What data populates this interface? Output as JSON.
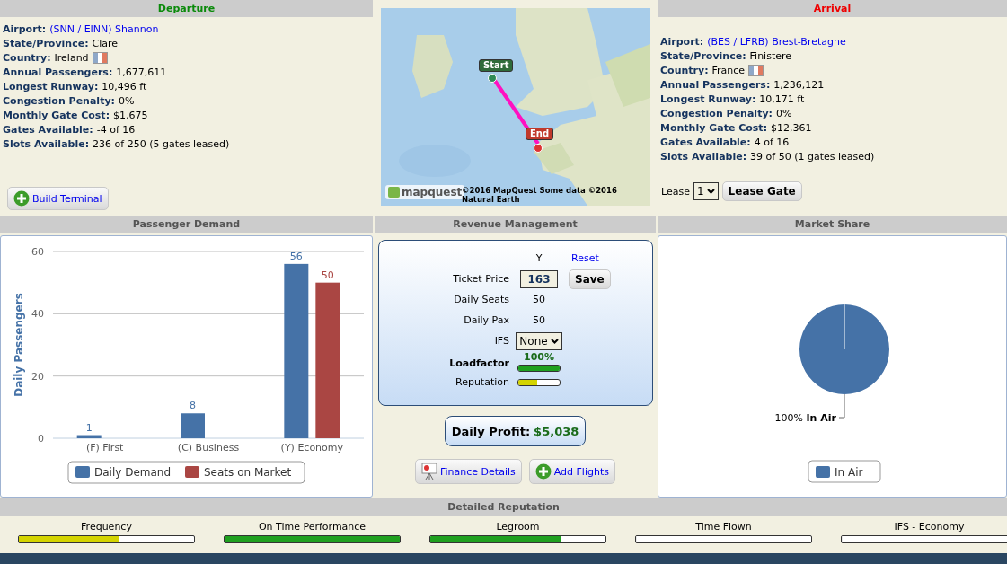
{
  "departure": {
    "title": "Departure",
    "fields": [
      {
        "label": "Airport:",
        "value": "(SNN / EINN) Shannon",
        "kind": "link"
      },
      {
        "label": "State/Province:",
        "value": "Clare",
        "kind": "text"
      },
      {
        "label": "Country:",
        "value": "Ireland",
        "kind": "flag"
      },
      {
        "label": "Annual Passengers:",
        "value": "1,677,611",
        "kind": "text"
      },
      {
        "label": "Longest Runway:",
        "value": "10,496 ft",
        "kind": "text"
      },
      {
        "label": "Congestion Penalty:",
        "value": "0%",
        "kind": "text"
      },
      {
        "label": "Monthly Gate Cost:",
        "value": "$1,675",
        "kind": "text"
      },
      {
        "label": "Gates Available:",
        "value": "-4 of 16",
        "kind": "text"
      },
      {
        "label": "Slots Available:",
        "value": "236 of 250 (5 gates leased)",
        "kind": "text"
      }
    ],
    "button": "Build Terminal"
  },
  "map": {
    "kind": "picture",
    "start_label": "Start",
    "end_label": "End",
    "logo": "mapquest",
    "attribution": "©2016 MapQuest Some data ©2016 Natural Earth"
  },
  "arrival": {
    "title": "Arrival",
    "fields": [
      {
        "label": "Airport:",
        "value": "(BES / LFRB) Brest-Bretagne",
        "kind": "link"
      },
      {
        "label": "State/Province:",
        "value": "Finistere",
        "kind": "text"
      },
      {
        "label": "Country:",
        "value": "France",
        "kind": "flag"
      },
      {
        "label": "Annual Passengers:",
        "value": "1,236,121",
        "kind": "text"
      },
      {
        "label": "Longest Runway:",
        "value": "10,171 ft",
        "kind": "text"
      },
      {
        "label": "Congestion Penalty:",
        "value": "0%",
        "kind": "text"
      },
      {
        "label": "Monthly Gate Cost:",
        "value": "$12,361",
        "kind": "text"
      },
      {
        "label": "Gates Available:",
        "value": "4 of 16",
        "kind": "text"
      },
      {
        "label": "Slots Available:",
        "value": "39 of 50 (1 gates leased)",
        "kind": "text"
      }
    ],
    "lease_label": "Lease",
    "lease_value": "1",
    "button": "Lease Gate"
  },
  "passenger_demand": {
    "title": "Passenger Demand",
    "chart_data": {
      "type": "bar",
      "ylabel": "Daily Passengers",
      "categories": [
        "(F) First",
        "(C) Business",
        "(Y) Economy"
      ],
      "series": [
        {
          "name": "Daily Demand",
          "color": "#4572a7",
          "values": [
            1,
            8,
            56
          ]
        },
        {
          "name": "Seats on Market",
          "color": "#aa4643",
          "values": [
            null,
            null,
            50
          ]
        }
      ],
      "ylim": [
        0,
        60
      ],
      "yticks": [
        0,
        20,
        40,
        60
      ],
      "data_labels": true,
      "legend": "bottom"
    }
  },
  "revenue": {
    "title": "Revenue Management",
    "column": "Y",
    "reset": "Reset",
    "rows": [
      {
        "kind": "input",
        "label": "Ticket Price",
        "value": "163",
        "button": "Save",
        "bold": false
      },
      {
        "kind": "text",
        "label": "Daily Seats",
        "value": "50",
        "bold": false
      },
      {
        "kind": "text",
        "label": "Daily Pax",
        "value": "50",
        "bold": false
      },
      {
        "kind": "select",
        "label": "IFS",
        "value": "None",
        "bold": false
      },
      {
        "kind": "meter",
        "label": "Loadfactor",
        "reading": "100%",
        "level": 1,
        "color": "#1fa01f",
        "bold": true
      },
      {
        "kind": "meter",
        "label": "Reputation",
        "level": 0.45,
        "color": "#d4d400",
        "bold": false
      }
    ],
    "profit_label": "Daily Profit:",
    "profit": "$5,038",
    "buttons": [
      {
        "kind": "finance",
        "label": "Finance Details"
      },
      {
        "kind": "add",
        "label": "Add Flights"
      }
    ]
  },
  "market_share": {
    "title": "Market Share",
    "chart_data": {
      "type": "pie",
      "categories": [
        "In Air"
      ],
      "series": [
        {
          "color": "#4572a7",
          "values": [
            100
          ]
        }
      ],
      "value_labels": [
        "100%"
      ],
      "needle": "In Air",
      "legend": "bottom"
    }
  },
  "reputation": {
    "title": "Detailed Reputation",
    "meters": [
      {
        "label": "Frequency",
        "level": 0.57,
        "color": "#d4d400"
      },
      {
        "label": "On Time Performance",
        "level": 1,
        "color": "#1fa01f"
      },
      {
        "label": "Legroom",
        "level": 0.75,
        "color": "#1fa01f"
      },
      {
        "label": "Time Flown",
        "level": 0
      },
      {
        "label": "IFS - Economy",
        "level": 0
      }
    ]
  }
}
